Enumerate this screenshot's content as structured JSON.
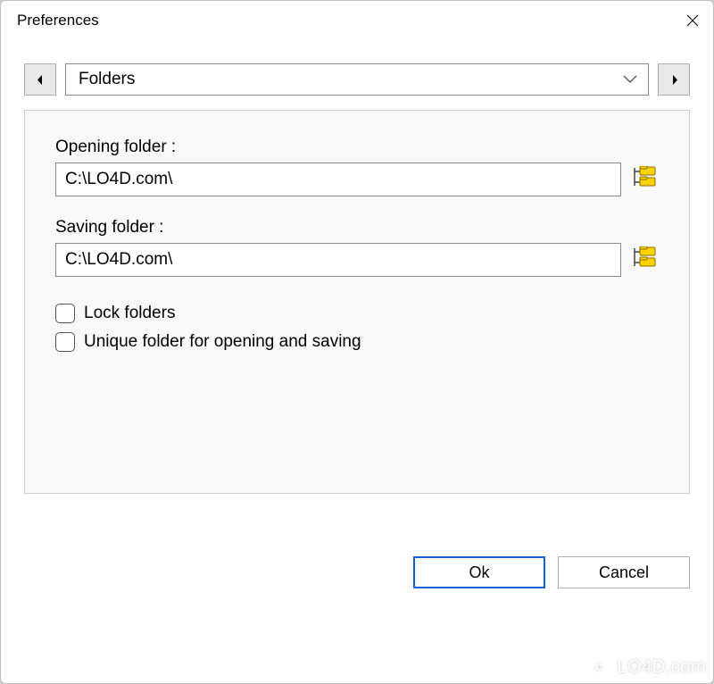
{
  "titlebar": {
    "title": "Preferences"
  },
  "nav": {
    "category": "Folders"
  },
  "fields": {
    "opening": {
      "label": "Opening folder :",
      "value": "C:\\LO4D.com\\"
    },
    "saving": {
      "label": "Saving folder :",
      "value": "C:\\LO4D.com\\"
    }
  },
  "checks": {
    "lock": {
      "label": "Lock folders",
      "checked": false
    },
    "unique": {
      "label": "Unique folder for opening and saving",
      "checked": false
    }
  },
  "buttons": {
    "ok": "Ok",
    "cancel": "Cancel"
  },
  "watermark": {
    "text": "LO4D.com"
  }
}
